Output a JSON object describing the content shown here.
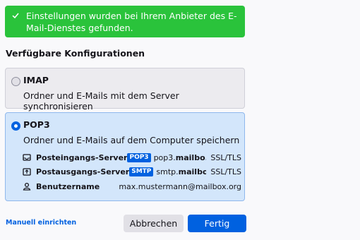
{
  "banner": {
    "icon": "checkmark-icon",
    "message": "Einstellungen wurden bei Ihrem Anbieter des E-Mail-Dienstes gefunden."
  },
  "configs": {
    "title": "Verfügbare Konfigurationen",
    "imap": {
      "selected": false,
      "title": "IMAP",
      "description": "Ordner und E-Mails mit dem Server synchronisieren"
    },
    "pop3": {
      "selected": true,
      "title": "POP3",
      "description": "Ordner und E-Mails auf dem Computer speichern",
      "incoming": {
        "icon": "inbox-icon",
        "label": "Posteingangs-Server",
        "protocol": "POP3",
        "host_prefix": "pop3.",
        "host_bold": "mailbo...",
        "security": "SSL/TLS"
      },
      "outgoing": {
        "icon": "outbox-icon",
        "label": "Postausgangs-Server",
        "protocol": "SMTP",
        "host_prefix": "smtp.",
        "host_bold": "mailbo...",
        "security": "SSL/TLS"
      },
      "username": {
        "icon": "user-icon",
        "label": "Benutzername",
        "value": "max.mustermann@mailbox.org"
      }
    }
  },
  "footer": {
    "manual_link": "Manuell einrichten",
    "cancel": "Abbrechen",
    "done": "Fertig"
  },
  "colors": {
    "success": "#2ac33b",
    "accent": "#0061e0",
    "selected_bg": "#d3e6fb"
  }
}
